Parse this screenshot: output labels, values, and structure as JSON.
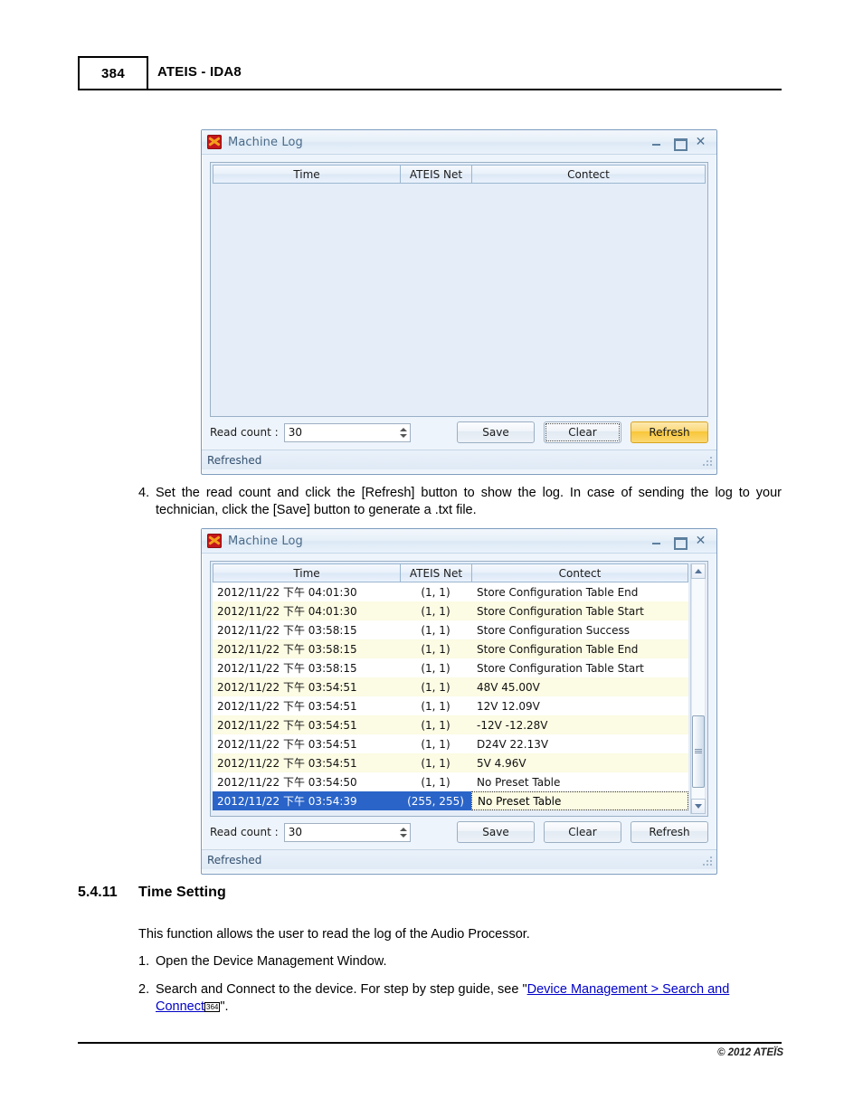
{
  "page": {
    "number": "384",
    "header_title": "ATEIS - IDA8",
    "footer_copyright": "© 2012 ATEÏS"
  },
  "dialog_empty": {
    "title": "Machine Log",
    "icon": "ateis-app-icon",
    "window_buttons": {
      "minimize": "minimize-icon",
      "maximize": "maximize-icon",
      "close": "close-icon"
    },
    "columns": [
      "Time",
      "ATEIS  Net",
      "Contect"
    ],
    "rows": [],
    "read_count_label": "Read count :",
    "read_count_value": "30",
    "buttons": {
      "save": "Save",
      "clear": "Clear",
      "refresh": "Refresh"
    },
    "button_states": {
      "save": "normal",
      "clear": "focused",
      "refresh": "hot"
    },
    "status": "Refreshed"
  },
  "dialog_filled": {
    "title": "Machine Log",
    "icon": "ateis-app-icon",
    "window_buttons": {
      "minimize": "minimize-icon",
      "maximize": "maximize-icon",
      "close": "close-icon"
    },
    "columns": [
      "Time",
      "ATEIS  Net",
      "Contect"
    ],
    "rows": [
      {
        "time": "2012/11/22 下午 04:01:30",
        "net": "(1, 1)",
        "contect": "Store Configuration Table End",
        "selected": false
      },
      {
        "time": "2012/11/22 下午 04:01:30",
        "net": "(1, 1)",
        "contect": "Store Configuration Table Start",
        "selected": false
      },
      {
        "time": "2012/11/22 下午 03:58:15",
        "net": "(1, 1)",
        "contect": "Store Configuration Success",
        "selected": false
      },
      {
        "time": "2012/11/22 下午 03:58:15",
        "net": "(1, 1)",
        "contect": "Store Configuration Table End",
        "selected": false
      },
      {
        "time": "2012/11/22 下午 03:58:15",
        "net": "(1, 1)",
        "contect": "Store Configuration Table Start",
        "selected": false
      },
      {
        "time": "2012/11/22 下午 03:54:51",
        "net": "(1, 1)",
        "contect": "48V 45.00V",
        "selected": false
      },
      {
        "time": "2012/11/22 下午 03:54:51",
        "net": "(1, 1)",
        "contect": "12V 12.09V",
        "selected": false
      },
      {
        "time": "2012/11/22 下午 03:54:51",
        "net": "(1, 1)",
        "contect": "-12V -12.28V",
        "selected": false
      },
      {
        "time": "2012/11/22 下午 03:54:51",
        "net": "(1, 1)",
        "contect": "D24V 22.13V",
        "selected": false
      },
      {
        "time": "2012/11/22 下午 03:54:51",
        "net": "(1, 1)",
        "contect": "5V 4.96V",
        "selected": false
      },
      {
        "time": "2012/11/22 下午 03:54:50",
        "net": "(1, 1)",
        "contect": "No Preset Table",
        "selected": false
      },
      {
        "time": "2012/11/22 下午 03:54:39",
        "net": "(255, 255)",
        "contect": "No Preset Table",
        "selected": true
      }
    ],
    "scrollbar": {
      "up": "scroll-up-arrow",
      "down": "scroll-down-arrow",
      "thumb_top_pct": 62,
      "thumb_height_pct": 33
    },
    "read_count_label": "Read count :",
    "read_count_value": "30",
    "buttons": {
      "save": "Save",
      "clear": "Clear",
      "refresh": "Refresh"
    },
    "button_states": {
      "save": "normal",
      "clear": "normal",
      "refresh": "normal"
    },
    "status": "Refreshed"
  },
  "body": {
    "step4_num": "4.",
    "step4_text": "Set the read count and click the [Refresh] button to show the log. In case of sending the log to your technician, click the [Save] button to generate a .txt file.",
    "section_number": "5.4.11",
    "section_title": "Time Setting",
    "intro": "This function allows the user to read the log of the Audio Processor.",
    "step1_num": "1.",
    "step1_text": "Open the Device Management Window.",
    "step2_num": "2.",
    "step2_lead": "Search and Connect to the device. For step by step guide, see \"",
    "step2_link_line1": "Device Management > Search and",
    "step2_link_line2": "Connect",
    "step2_pageref": "364",
    "step2_tail": "\"."
  },
  "colors": {
    "accent_selected_row": "#2a64c8",
    "alt_row": "#fcfbe3",
    "hot_button": "#f8c637",
    "link": "#0000c8",
    "window_border": "#7b9bbd"
  }
}
